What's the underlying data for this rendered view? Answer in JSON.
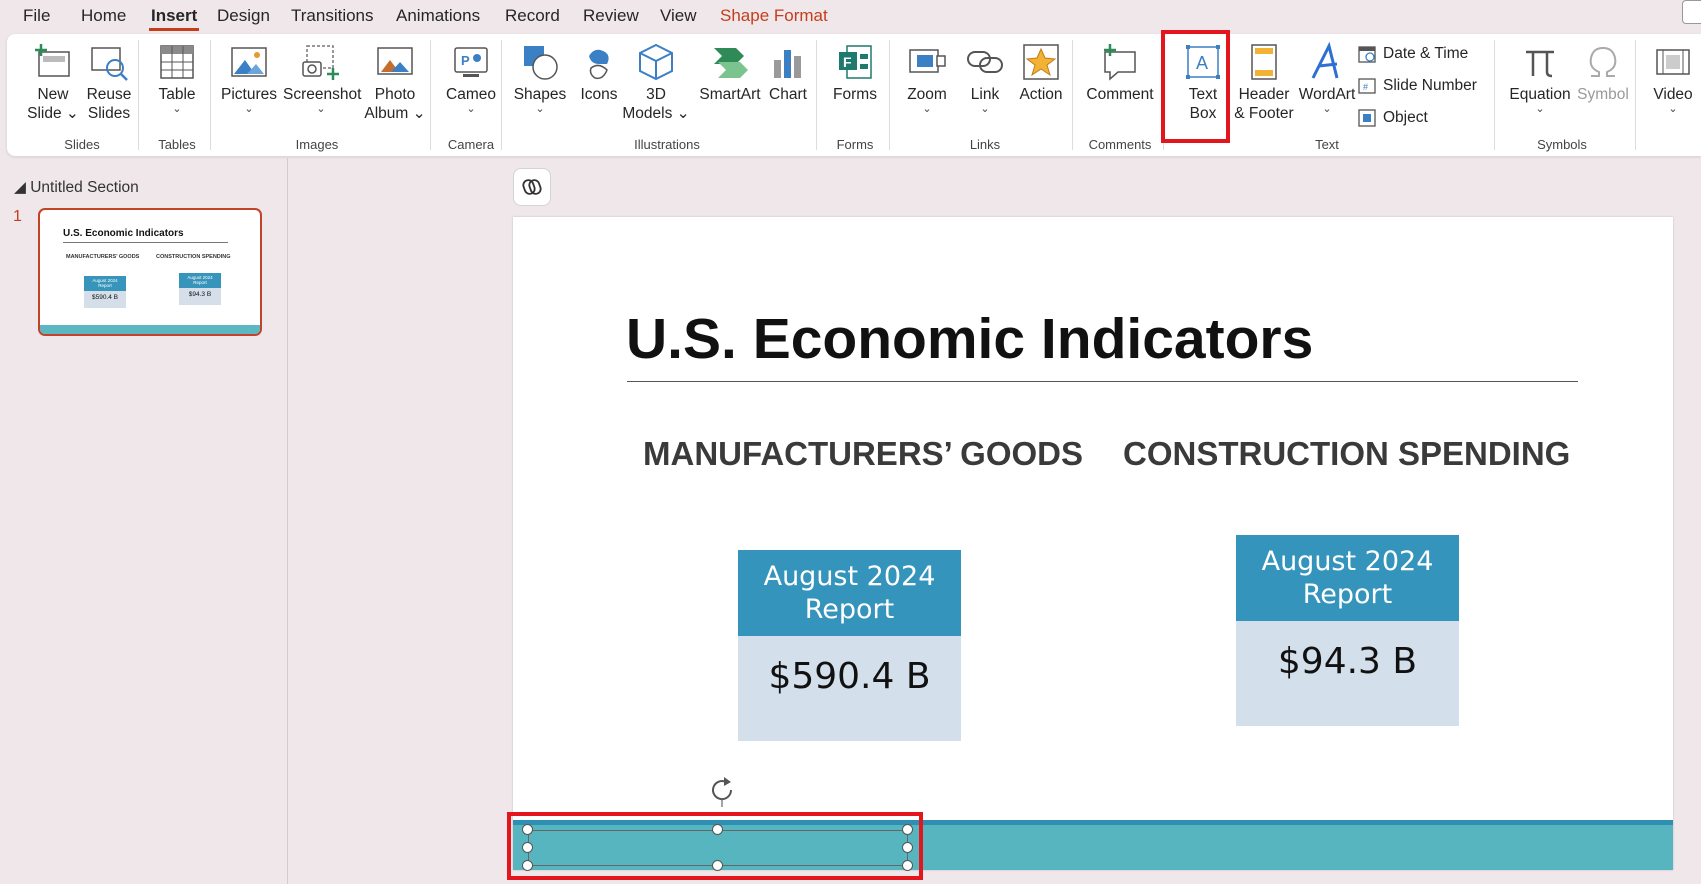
{
  "menu": {
    "items": [
      "File",
      "Home",
      "Insert",
      "Design",
      "Transitions",
      "Animations",
      "Record",
      "Review",
      "View",
      "Shape Format"
    ],
    "active": "Insert"
  },
  "ribbon": {
    "new_slide": [
      "New",
      "Slide"
    ],
    "reuse_slides": [
      "Reuse",
      "Slides"
    ],
    "table": "Table",
    "pictures": "Pictures",
    "screenshot": "Screenshot",
    "photo_album": [
      "Photo",
      "Album"
    ],
    "cameo": "Cameo",
    "shapes": "Shapes",
    "icons": "Icons",
    "models_3d": [
      "3D",
      "Models"
    ],
    "smartart": "SmartArt",
    "chart": "Chart",
    "forms": "Forms",
    "zoom": "Zoom",
    "link": "Link",
    "action": "Action",
    "comment": "Comment",
    "text_box": [
      "Text",
      "Box"
    ],
    "header_footer": [
      "Header",
      "& Footer"
    ],
    "wordart": "WordArt",
    "date_time": "Date & Time",
    "slide_number": "Slide Number",
    "object": "Object",
    "equation": "Equation",
    "symbol": "Symbol",
    "video": "Video",
    "groups": {
      "slides": "Slides",
      "tables": "Tables",
      "images": "Images",
      "camera": "Camera",
      "illustrations": "Illustrations",
      "forms": "Forms",
      "links": "Links",
      "comments": "Comments",
      "text": "Text",
      "symbols": "Symbols"
    }
  },
  "left_pane": {
    "section": "Untitled Section",
    "slide_number": "1"
  },
  "slide": {
    "title": "U.S. Economic Indicators",
    "left_heading": "MANUFACTURERS’ GOODS",
    "right_heading": "CONSTRUCTION SPENDING",
    "left_card": {
      "line1": "August 2024",
      "line2": "Report",
      "value": "$590.4 B"
    },
    "right_card": {
      "line1": "August 2024",
      "line2": "Report",
      "value": "$94.3 B"
    }
  },
  "colors": {
    "accent": "#c43e1c",
    "highlight": "#e3161d",
    "card_header": "#3594bb",
    "card_body": "#d3dfea",
    "footer_band": "#56b5bf"
  }
}
